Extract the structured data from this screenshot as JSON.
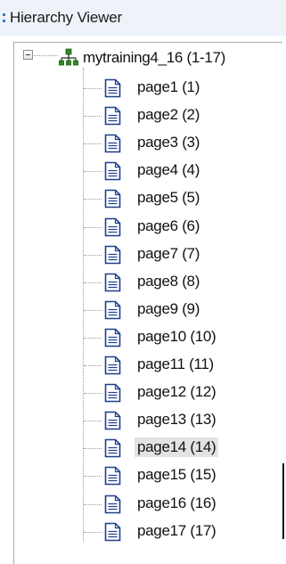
{
  "title_bar": {
    "title": "Hierarchy Viewer"
  },
  "tree": {
    "root": {
      "label": "mytraining4_16 (1-17)",
      "expanded": true,
      "icon": "hierarchy-icon"
    },
    "selected_index": 13,
    "items": [
      {
        "label": "page1 (1)"
      },
      {
        "label": "page2 (2)"
      },
      {
        "label": "page3 (3)"
      },
      {
        "label": "page4 (4)"
      },
      {
        "label": "page5 (5)"
      },
      {
        "label": "page6 (6)"
      },
      {
        "label": "page7 (7)"
      },
      {
        "label": "page8 (8)"
      },
      {
        "label": "page9 (9)"
      },
      {
        "label": "page10 (10)"
      },
      {
        "label": "page11 (11)"
      },
      {
        "label": "page12 (12)"
      },
      {
        "label": "page13 (13)"
      },
      {
        "label": "page14 (14)"
      },
      {
        "label": "page15 (15)"
      },
      {
        "label": "page16 (16)"
      },
      {
        "label": "page17 (17)"
      }
    ]
  },
  "colors": {
    "accent": "#2f7fd0",
    "root_icon": "#2e8b1e",
    "page_icon": "#1c3f8f",
    "selection": "#e3e3e3"
  }
}
